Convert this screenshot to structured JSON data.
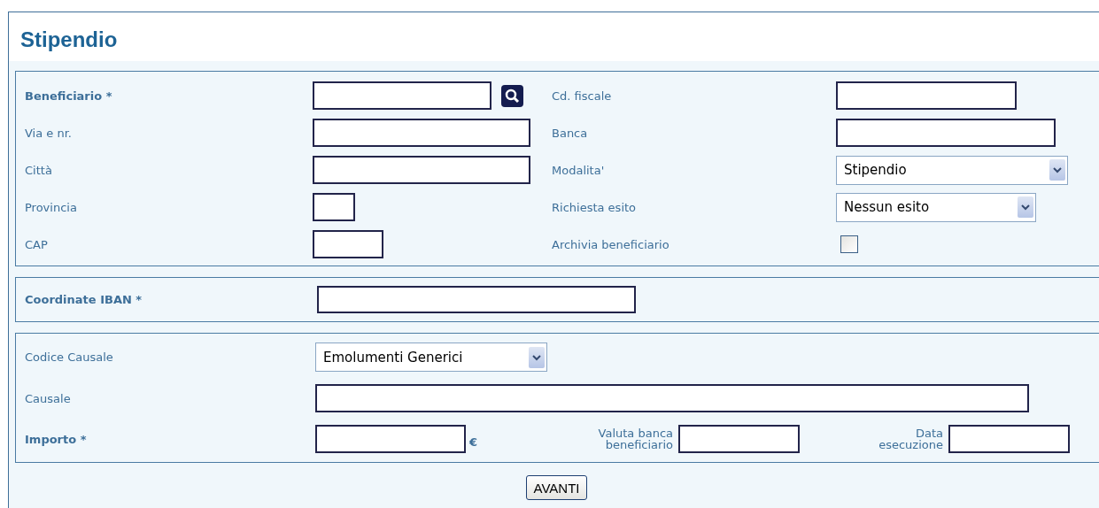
{
  "title": "Stipendio",
  "beneficiary": {
    "left": [
      {
        "label": "Beneficiario *",
        "required": true,
        "kind": "text",
        "search": true
      },
      {
        "label": "Via e nr.",
        "required": false,
        "kind": "text"
      },
      {
        "label": "Città",
        "required": false,
        "kind": "text"
      },
      {
        "label": "Provincia",
        "required": false,
        "kind": "text"
      },
      {
        "label": "CAP",
        "required": false,
        "kind": "text"
      }
    ],
    "right": [
      {
        "label": "Cd. fiscale",
        "required": false,
        "kind": "text"
      },
      {
        "label": "Banca",
        "required": false,
        "kind": "text"
      },
      {
        "label": "Modalita'",
        "required": false,
        "kind": "select",
        "value": "Stipendio"
      },
      {
        "label": "Richiesta esito",
        "required": false,
        "kind": "select",
        "value": "Nessun esito"
      },
      {
        "label": "Archivia beneficiario",
        "required": false,
        "kind": "checkbox",
        "checked": false
      }
    ]
  },
  "iban": {
    "label": "Coordinate IBAN *",
    "required": true
  },
  "payment": {
    "causal_code": {
      "label": "Codice Causale",
      "required": false,
      "value": "Emolumenti Generici"
    },
    "causal": {
      "label": "Causale",
      "required": false
    },
    "amount": {
      "label": "Importo *",
      "required": true,
      "currency": "€"
    },
    "value_date": {
      "label": "Valuta banca beneficiario"
    },
    "execution_date": {
      "label": "Data esecuzione"
    }
  },
  "submit": "AVANTI"
}
